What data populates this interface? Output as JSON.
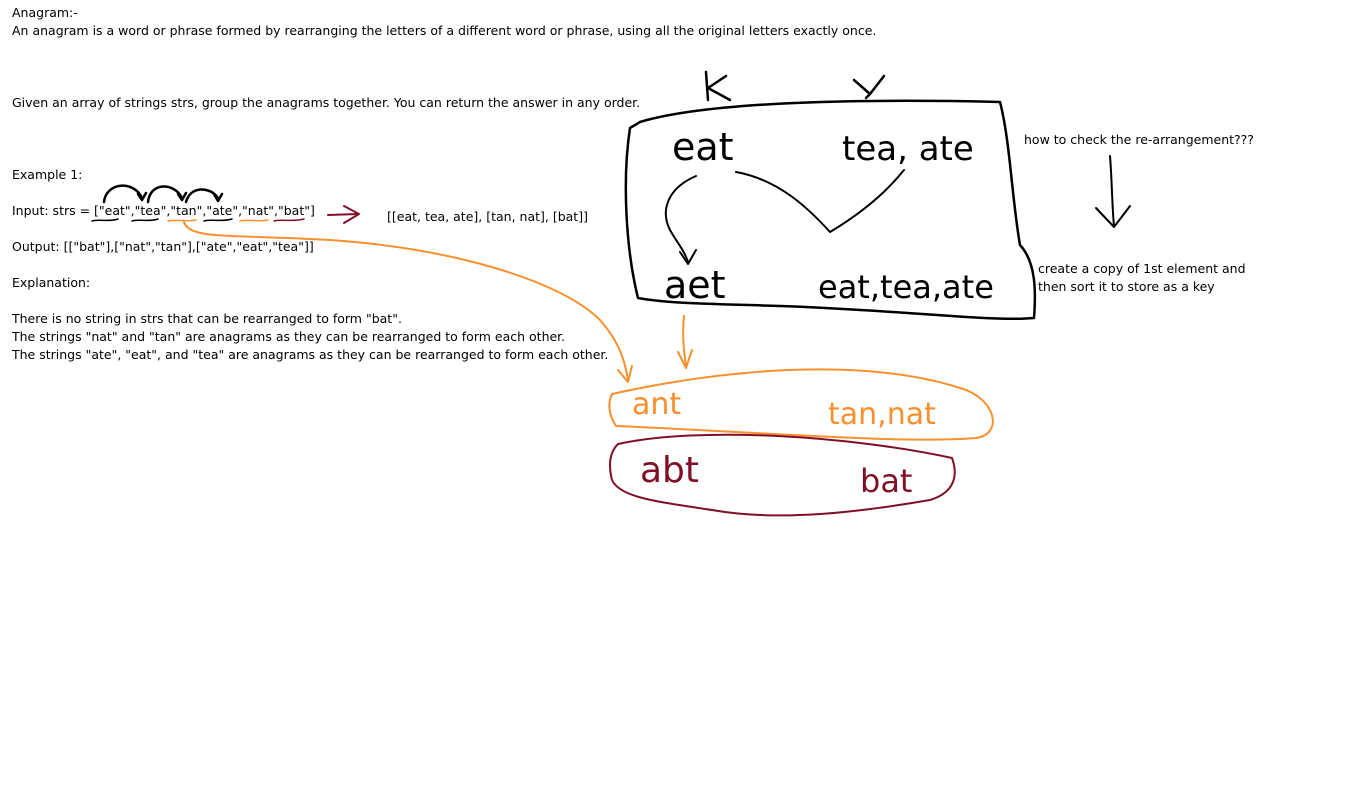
{
  "doc": {
    "title": "Anagram:-",
    "definition": "An anagram is a word or phrase formed by rearranging the letters of a different word or phrase, using all the original letters exactly once.",
    "problem": "Given an array of strings strs, group the anagrams together. You can return the answer in any order.",
    "example_label": "Example 1:",
    "input": "Input: strs = [\"eat\",\"tea\",\"tan\",\"ate\",\"nat\",\"bat\"]",
    "output": "Output: [[\"bat\"],[\"nat\",\"tan\"],[\"ate\",\"eat\",\"tea\"]]",
    "explanation_label": "Explanation:",
    "explanation_lines": [
      "There is no string in strs that can be rearranged to form \"bat\".",
      "The strings \"nat\" and \"tan\" are anagrams as they can be rearranged to form each other.",
      "The strings \"ate\", \"eat\", and \"tea\" are anagrams as they can be rearranged to form each other."
    ]
  },
  "notes": {
    "grouped_result": "[[eat, tea, ate], [tan, nat], [bat]]",
    "question": "how to check the re-arrangement???",
    "answer_line1": "create a copy of 1st element and",
    "answer_line2": "then sort it to store as a key"
  },
  "sketch": {
    "k_label": "K",
    "v_label": "V",
    "key_word": "eat",
    "value_words": "tea, ate",
    "sorted_key": "aet",
    "grouped_values": "eat,tea,ate",
    "key_ant": "ant",
    "values_ant": "tan,nat",
    "key_abt": "abt",
    "values_abt": "bat"
  },
  "colors": {
    "ink": "#000000",
    "orange": "#f7902d",
    "maroon": "#7f1027"
  }
}
